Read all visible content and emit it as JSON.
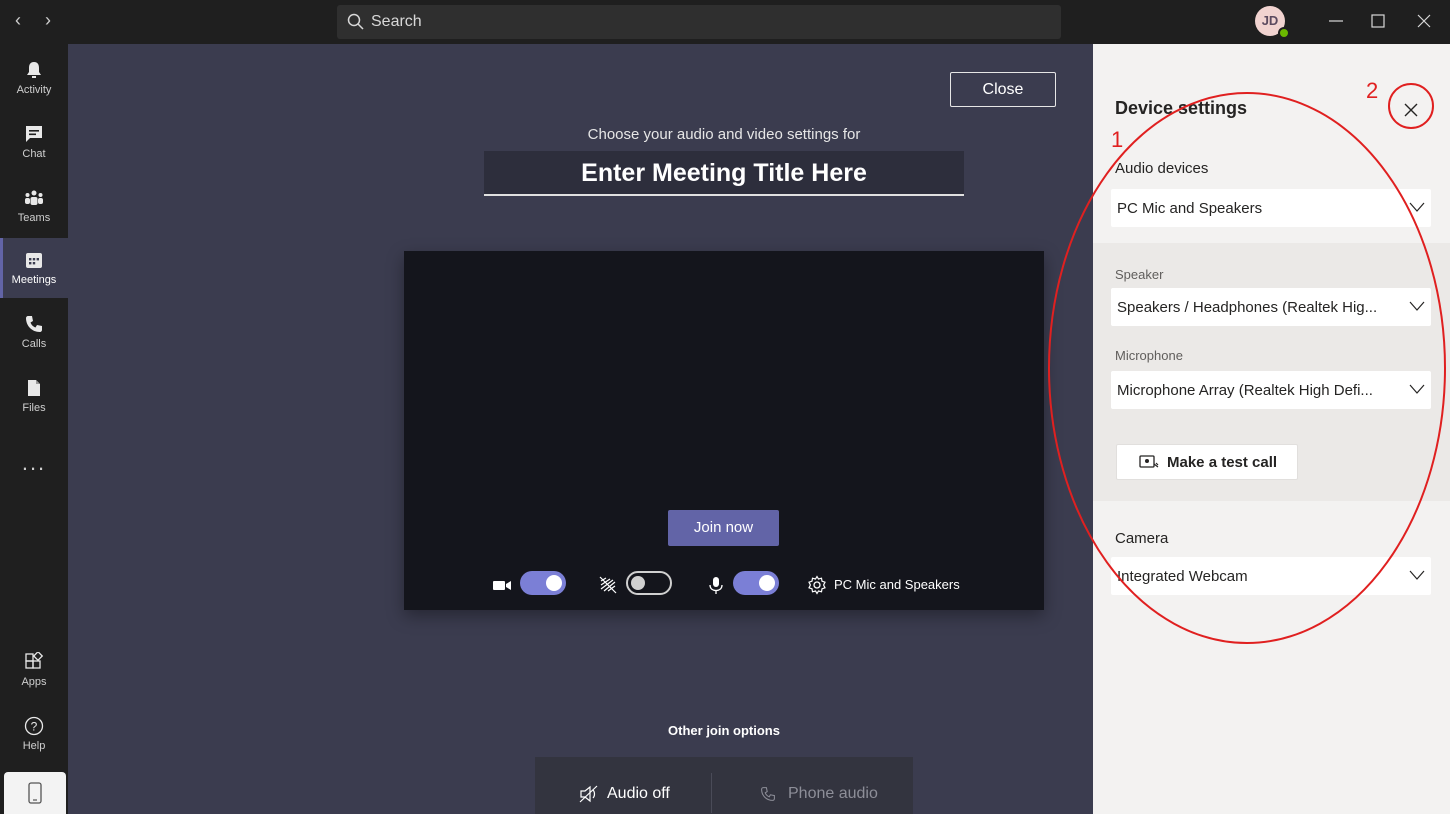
{
  "titlebar": {
    "search_placeholder": "Search",
    "avatar_initials": "JD",
    "back_icon": "chevron-left-icon",
    "forward_icon": "chevron-right-icon"
  },
  "rail": {
    "items": [
      {
        "label": "Activity",
        "icon": "bell-icon"
      },
      {
        "label": "Chat",
        "icon": "chat-icon"
      },
      {
        "label": "Teams",
        "icon": "teams-icon"
      },
      {
        "label": "Meetings",
        "icon": "calendar-icon",
        "active": true
      },
      {
        "label": "Calls",
        "icon": "phone-icon"
      },
      {
        "label": "Files",
        "icon": "file-icon"
      }
    ],
    "more": "...",
    "bottom_items": [
      {
        "label": "Apps",
        "icon": "apps-icon"
      },
      {
        "label": "Help",
        "icon": "help-icon"
      }
    ]
  },
  "main": {
    "close_label": "Close",
    "choose_text": "Choose your audio and video settings for",
    "meeting_title": "Enter Meeting Title Here",
    "join_label": "Join now",
    "device_label": "PC Mic and Speakers",
    "other_join_title": "Other join options",
    "audio_off_label": "Audio off",
    "phone_audio_label": "Phone audio"
  },
  "device_panel": {
    "title": "Device settings",
    "audio_devices_title": "Audio devices",
    "audio_device_value": "PC Mic and Speakers",
    "speaker_label": "Speaker",
    "speaker_value": "Speakers / Headphones (Realtek Hig...",
    "microphone_label": "Microphone",
    "microphone_value": "Microphone Array (Realtek High Defi...",
    "test_call_label": "Make a test call",
    "camera_title": "Camera",
    "camera_value": "Integrated Webcam"
  },
  "annotations": {
    "label_1": "1",
    "label_2": "2",
    "color": "#e02020"
  },
  "colors": {
    "accent": "#6264a7",
    "toggle_on": "#7b7fd6",
    "status_available": "#6bb700"
  }
}
